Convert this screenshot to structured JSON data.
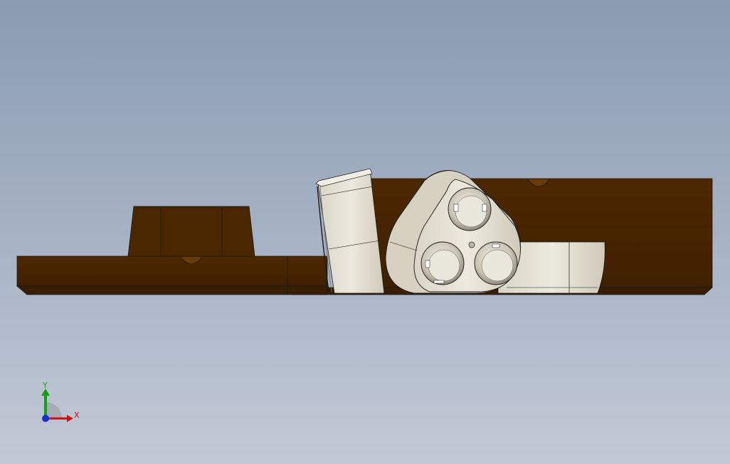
{
  "viewport": {
    "background_top": "#8a9bb2",
    "background_bottom": "#c2c9d6"
  },
  "model": {
    "body_color": "#4a2600",
    "body_edge_color": "#2e1700",
    "part_color": "#e4e0d2",
    "part_shadow_color": "#b9b4a4",
    "line_color": "#1a1a1a"
  },
  "triad": {
    "x_label": "X",
    "y_label": "Y",
    "x_color": "#d01010",
    "y_color": "#10a010",
    "z_color": "#1030d0"
  }
}
